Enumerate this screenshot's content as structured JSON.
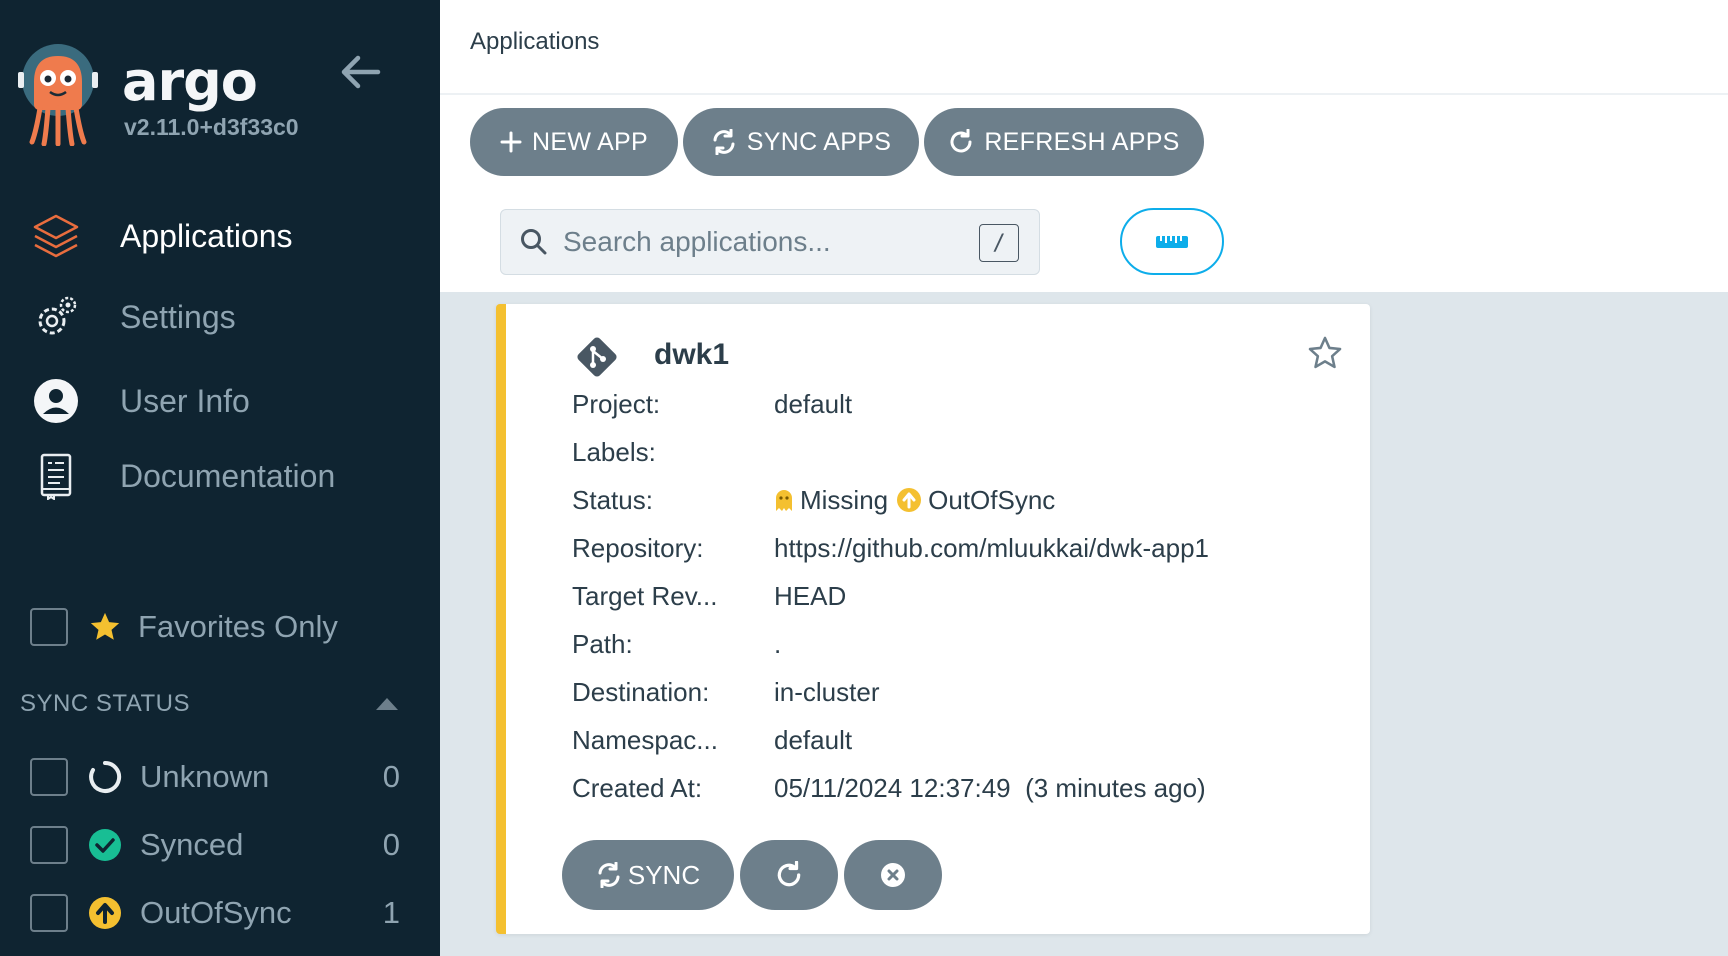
{
  "sidebar": {
    "brand": "argo",
    "version": "v2.11.0+d3f33c0",
    "nav": [
      {
        "label": "Applications",
        "icon": "layers-icon",
        "active": true
      },
      {
        "label": "Settings",
        "icon": "gears-icon",
        "active": false
      },
      {
        "label": "User Info",
        "icon": "user-icon",
        "active": false
      },
      {
        "label": "Documentation",
        "icon": "book-icon",
        "active": false
      }
    ],
    "favorites_label": "Favorites Only",
    "sync_status": {
      "title": "SYNC STATUS",
      "items": [
        {
          "label": "Unknown",
          "count": "0",
          "icon": "circle-notch-icon"
        },
        {
          "label": "Synced",
          "count": "0",
          "icon": "check-circle-icon"
        },
        {
          "label": "OutOfSync",
          "count": "1",
          "icon": "arrow-up-circle-icon"
        }
      ]
    }
  },
  "header": {
    "title": "Applications"
  },
  "toolbar": {
    "new_app": "NEW APP",
    "sync_apps": "SYNC APPS",
    "refresh_apps": "REFRESH APPS"
  },
  "search": {
    "placeholder": "Search applications...",
    "shortcut": "/"
  },
  "app": {
    "name": "dwk1",
    "fields": {
      "project_label": "Project:",
      "project": "default",
      "labels_label": "Labels:",
      "labels": "",
      "status_label": "Status:",
      "health": "Missing",
      "sync": "OutOfSync",
      "repo_label": "Repository:",
      "repo": "https://github.com/mluukkai/dwk-app1",
      "target_label": "Target Rev...",
      "target": "HEAD",
      "path_label": "Path:",
      "path": ".",
      "dest_label": "Destination:",
      "dest": "in-cluster",
      "ns_label": "Namespac...",
      "ns": "default",
      "created_label": "Created At:",
      "created": "05/11/2024 12:37:49  (3 minutes ago)"
    },
    "sync_button": "SYNC"
  },
  "colors": {
    "sidebar_bg": "#0f2431",
    "button_bg": "#6d7f8b",
    "accent_orange": "#f4c030",
    "synced_green": "#18be94",
    "toggle_blue": "#0dadea"
  }
}
